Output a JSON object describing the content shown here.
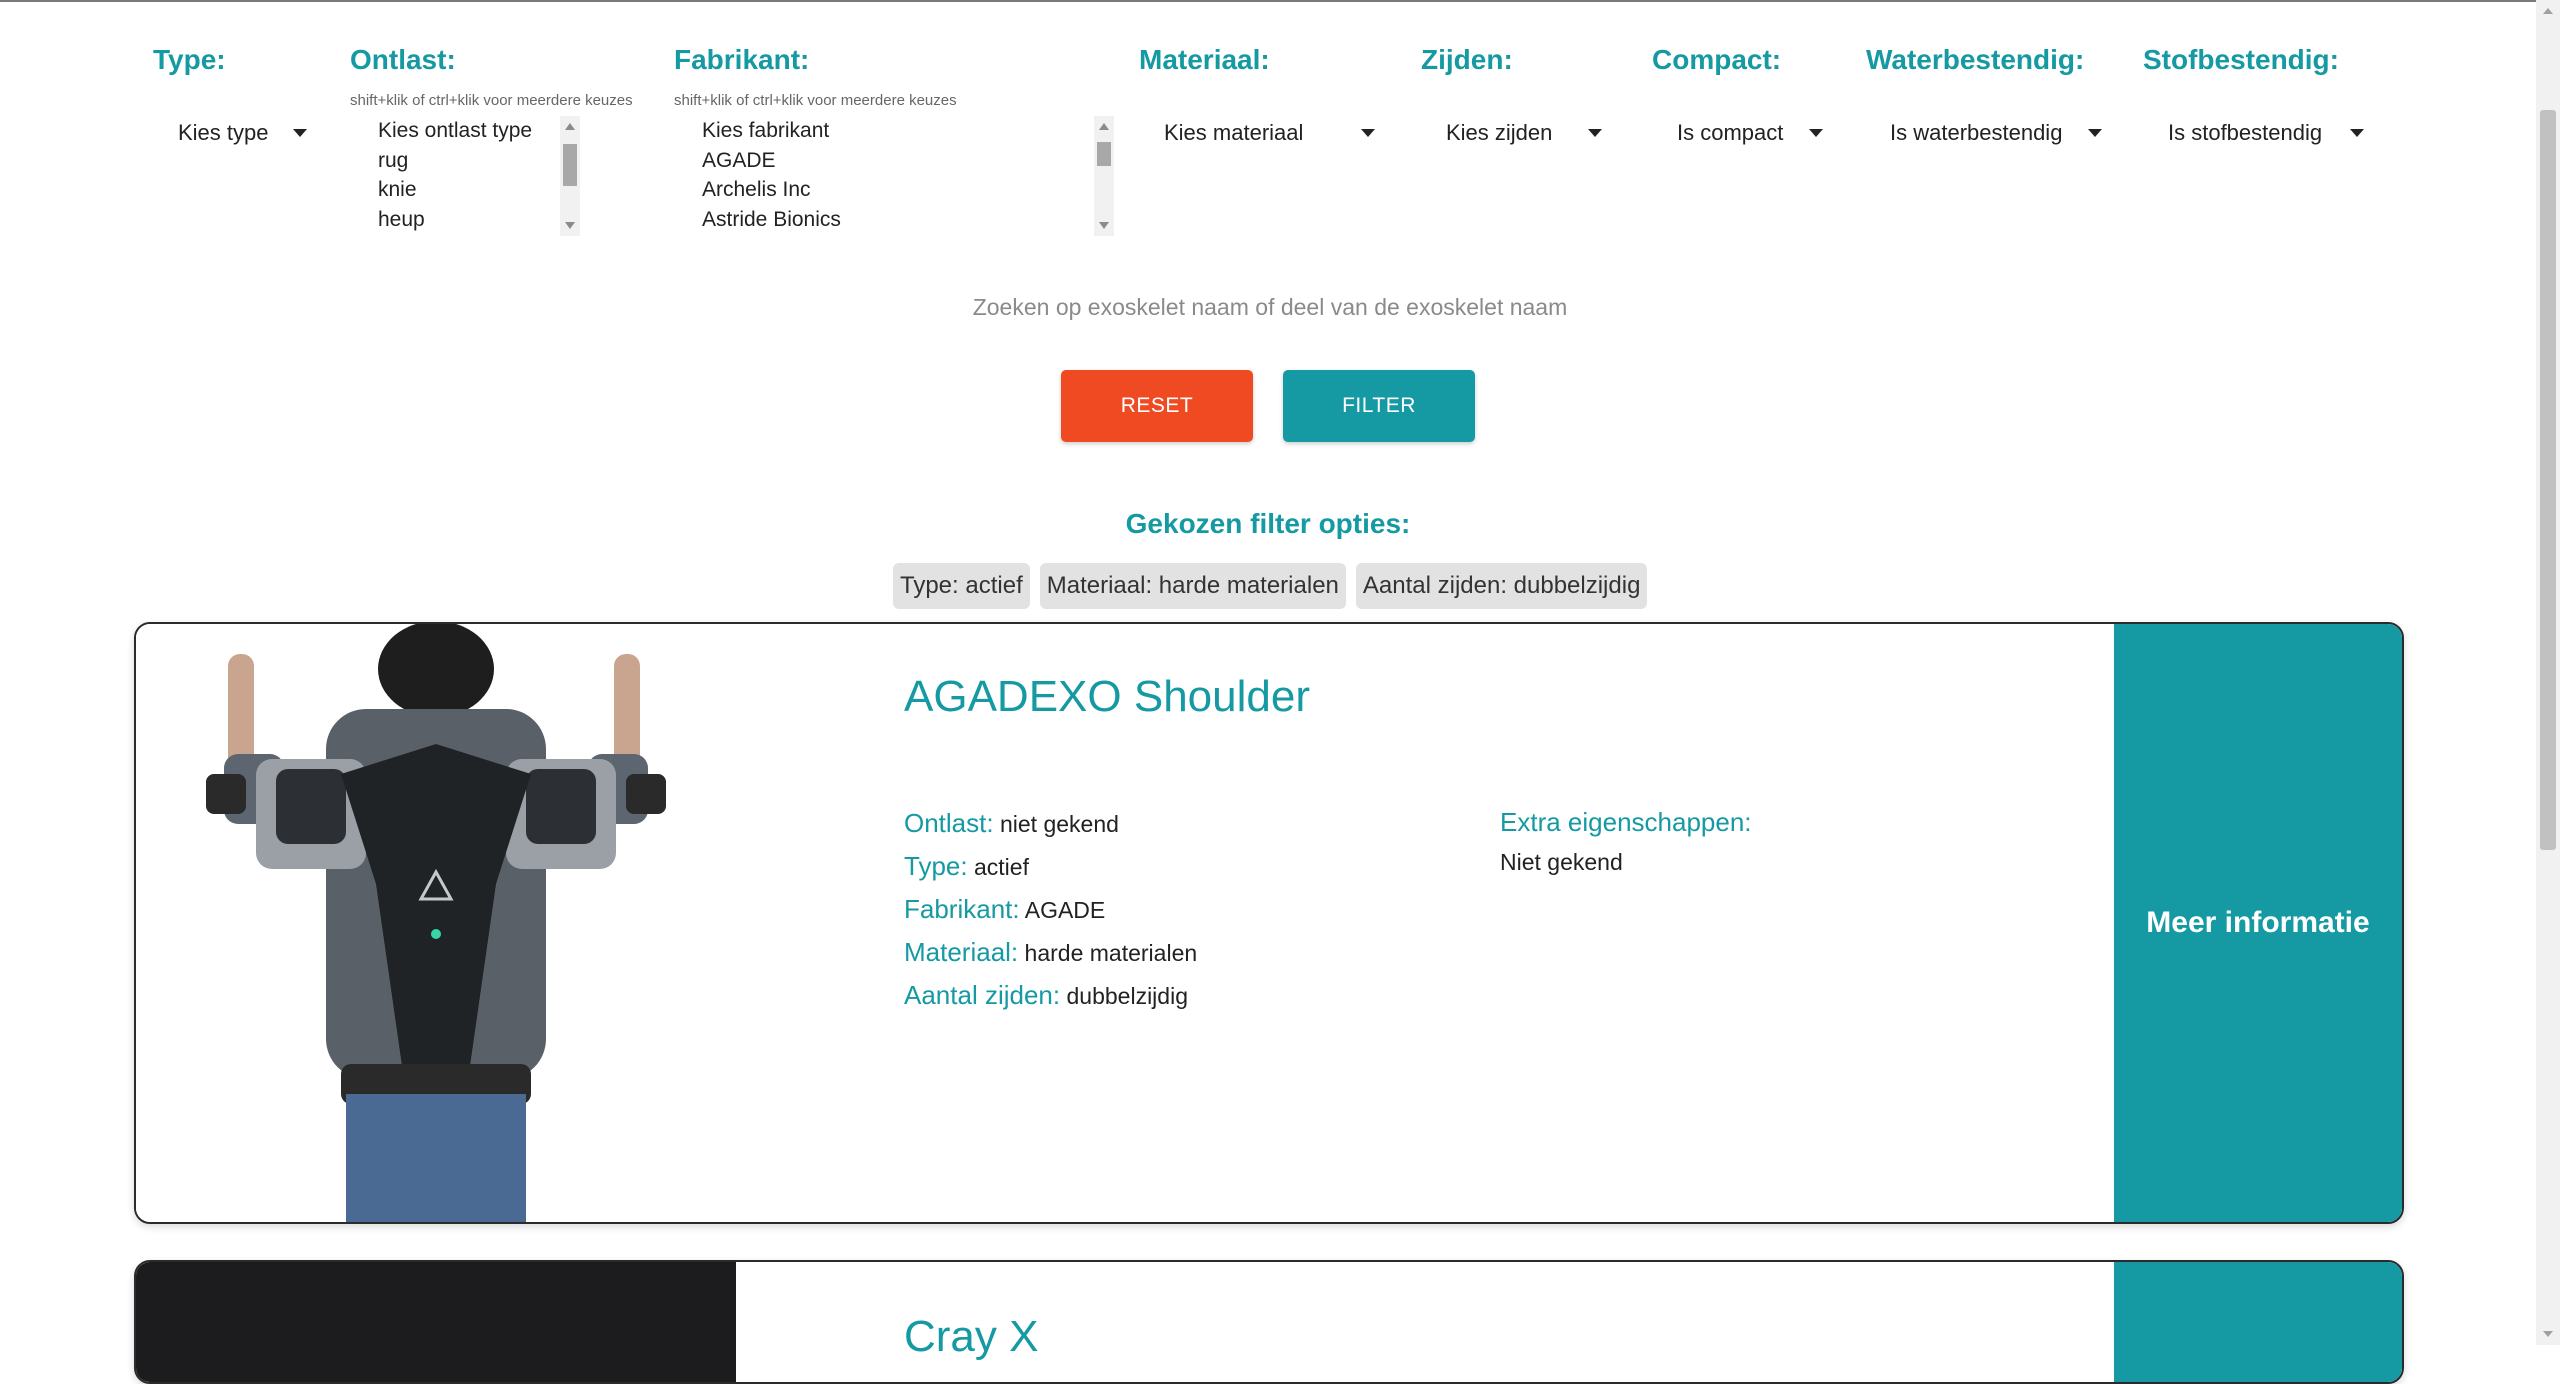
{
  "filters": {
    "type": {
      "label": "Type:",
      "value": "Kies type"
    },
    "ontlast": {
      "label": "Ontlast:",
      "hint": "shift+klik of ctrl+klik voor meerdere keuzes",
      "options": [
        "Kies ontlast type",
        "rug",
        "knie",
        "heup"
      ]
    },
    "fabrikant": {
      "label": "Fabrikant:",
      "hint": "shift+klik of ctrl+klik voor meerdere keuzes",
      "options": [
        "Kies fabrikant",
        "AGADE",
        "Archelis Inc",
        "Astride Bionics"
      ]
    },
    "materiaal": {
      "label": "Materiaal:",
      "value": "Kies materiaal"
    },
    "zijden": {
      "label": "Zijden:",
      "value": "Kies zijden"
    },
    "compact": {
      "label": "Compact:",
      "value": "Is compact"
    },
    "waterbestendig": {
      "label": "Waterbestendig:",
      "value": "Is waterbestendig"
    },
    "stofbestendig": {
      "label": "Stofbestendig:",
      "value": "Is stofbestendig"
    }
  },
  "search": {
    "placeholder": "Zoeken op exoskelet naam of deel van de exoskelet naam"
  },
  "buttons": {
    "reset": "RESET",
    "filter": "FILTER"
  },
  "chosen": {
    "title": "Gekozen filter opties:",
    "chips": [
      "Type: actief",
      "Materiaal: harde materialen",
      "Aantal zijden: dubbelzijdig"
    ]
  },
  "results": [
    {
      "name": "AGADEXO Shoulder",
      "props": [
        {
          "key": "Ontlast:",
          "value": "niet gekend"
        },
        {
          "key": "Type:",
          "value": "actief"
        },
        {
          "key": "Fabrikant:",
          "value": "AGADE"
        },
        {
          "key": "Materiaal:",
          "value": "harde materialen"
        },
        {
          "key": "Aantal zijden:",
          "value": "dubbelzijdig"
        }
      ],
      "extra_label": "Extra eigenschappen:",
      "extra_value": "Niet gekend",
      "more": "Meer informatie"
    },
    {
      "name": "Cray X"
    }
  ],
  "colors": {
    "accent": "#1599a3",
    "reset": "#f04a23"
  }
}
